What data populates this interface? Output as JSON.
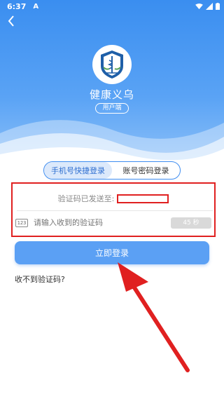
{
  "status": {
    "time": "6:37",
    "notification": "A"
  },
  "app": {
    "title": "健康义乌",
    "badge": "用户端"
  },
  "tabs": [
    {
      "label": "手机号快捷登录",
      "active": true
    },
    {
      "label": "账号密码登录",
      "active": false
    }
  ],
  "form": {
    "sent_label": "验证码已发送至:",
    "code_icon": "123",
    "code_placeholder": "请输入收到的验证码",
    "countdown": "45 秒"
  },
  "login_label": "立即登录",
  "no_code_label": "收不到验证码?",
  "colors": {
    "primary": "#3d8cf0",
    "annotation": "#e02020"
  }
}
